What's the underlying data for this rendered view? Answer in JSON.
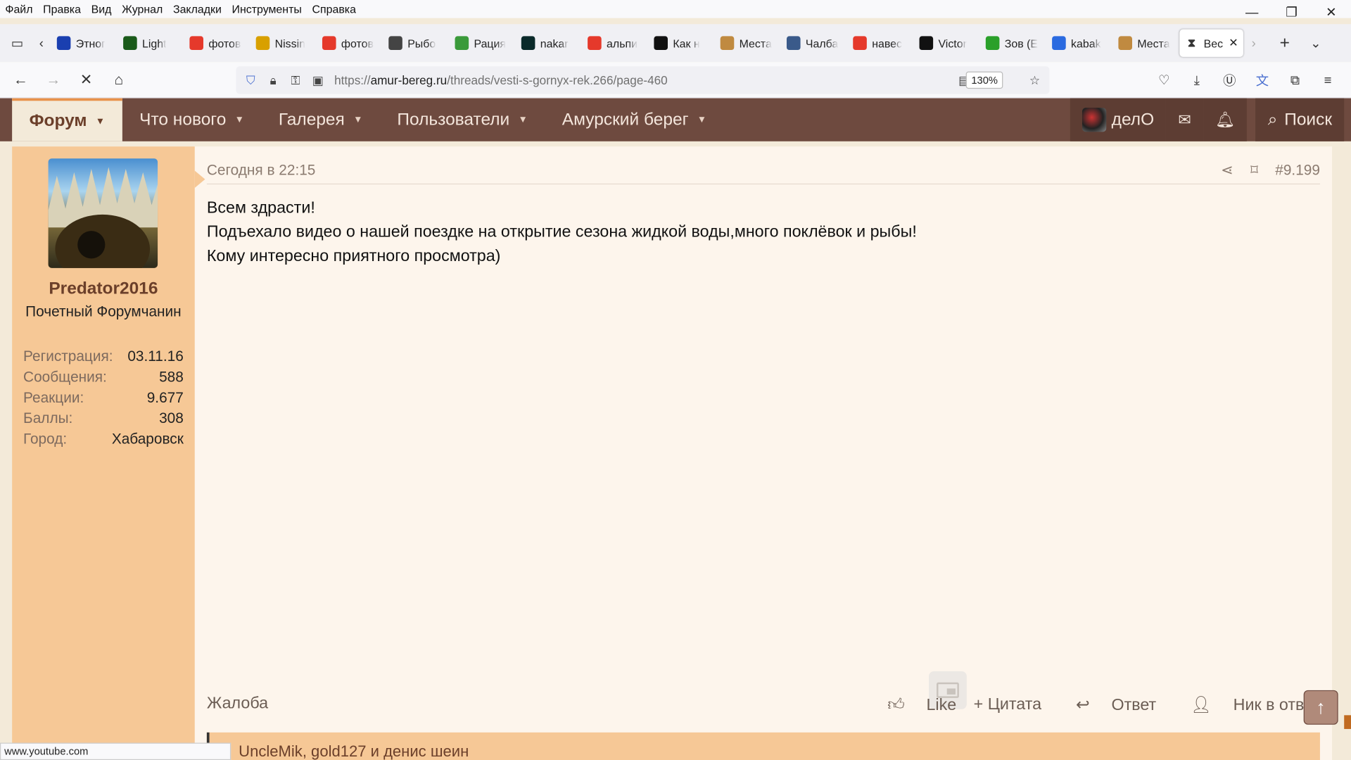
{
  "menubar": {
    "items": [
      "Файл",
      "Правка",
      "Вид",
      "Журнал",
      "Закладки",
      "Инструменты",
      "Справка"
    ]
  },
  "window_controls": {
    "minimize": "—",
    "restore": "❐",
    "close": "✕"
  },
  "tabs": [
    {
      "label": "Этног",
      "color": "#1a3fb0"
    },
    {
      "label": "Light",
      "color": "#1a5a1a"
    },
    {
      "label": "фотов",
      "color": "#e5392b"
    },
    {
      "label": "Nissin",
      "color": "#d8a000"
    },
    {
      "label": "фотов",
      "color": "#e5392b"
    },
    {
      "label": "Рыбо",
      "color": "#444444"
    },
    {
      "label": "Рация",
      "color": "#3a9a3a"
    },
    {
      "label": "nakar",
      "color": "#0a2a2a"
    },
    {
      "label": "альпи",
      "color": "#e5392b"
    },
    {
      "label": "Как н",
      "color": "#111111"
    },
    {
      "label": "Места",
      "color": "#c08a40"
    },
    {
      "label": "Чалба",
      "color": "#3a5a8a"
    },
    {
      "label": "навес",
      "color": "#e5392b"
    },
    {
      "label": "Victor",
      "color": "#111111"
    },
    {
      "label": "Зов (Е",
      "color": "#2aa02a"
    },
    {
      "label": "kabak",
      "color": "#2a6ae0"
    },
    {
      "label": "Места",
      "color": "#c08a40"
    }
  ],
  "active_tab": {
    "label": "Вес",
    "close": "✕"
  },
  "navbar": {
    "url_prefix": "https://",
    "url_host": "amur-bereg.ru",
    "url_path": "/threads/vesti-s-gornyx-rek.266/page-460",
    "zoom": "130%"
  },
  "forum_nav": {
    "items": [
      "Форум",
      "Что нового",
      "Галерея",
      "Пользователи",
      "Амурский берег"
    ],
    "username": "делО",
    "search": "Поиск"
  },
  "post": {
    "time": "Сегодня в 22:15",
    "number": "#9.199",
    "lines": [
      "Всем здрасти!",
      "Подъехало видео о нашей поездке на открытие сезона жидкой воды,много поклёвок и рыбы!",
      "Кому интересно приятного просмотра)"
    ],
    "report": "Жалоба",
    "actions": [
      "Like",
      "+ Цитата",
      "Ответ",
      "Ник в ответ"
    ],
    "reactions": "UncleMik, gold127 и денис шеин"
  },
  "user": {
    "name": "Predator2016",
    "title": "Почетный Форумчанин",
    "stats": [
      {
        "k": "Регистрация:",
        "v": "03.11.16"
      },
      {
        "k": "Сообщения:",
        "v": "588"
      },
      {
        "k": "Реакции:",
        "v": "9.677"
      },
      {
        "k": "Баллы:",
        "v": "308"
      },
      {
        "k": "Город:",
        "v": "Хабаровск"
      }
    ]
  },
  "status_bar": "www.youtube.com"
}
